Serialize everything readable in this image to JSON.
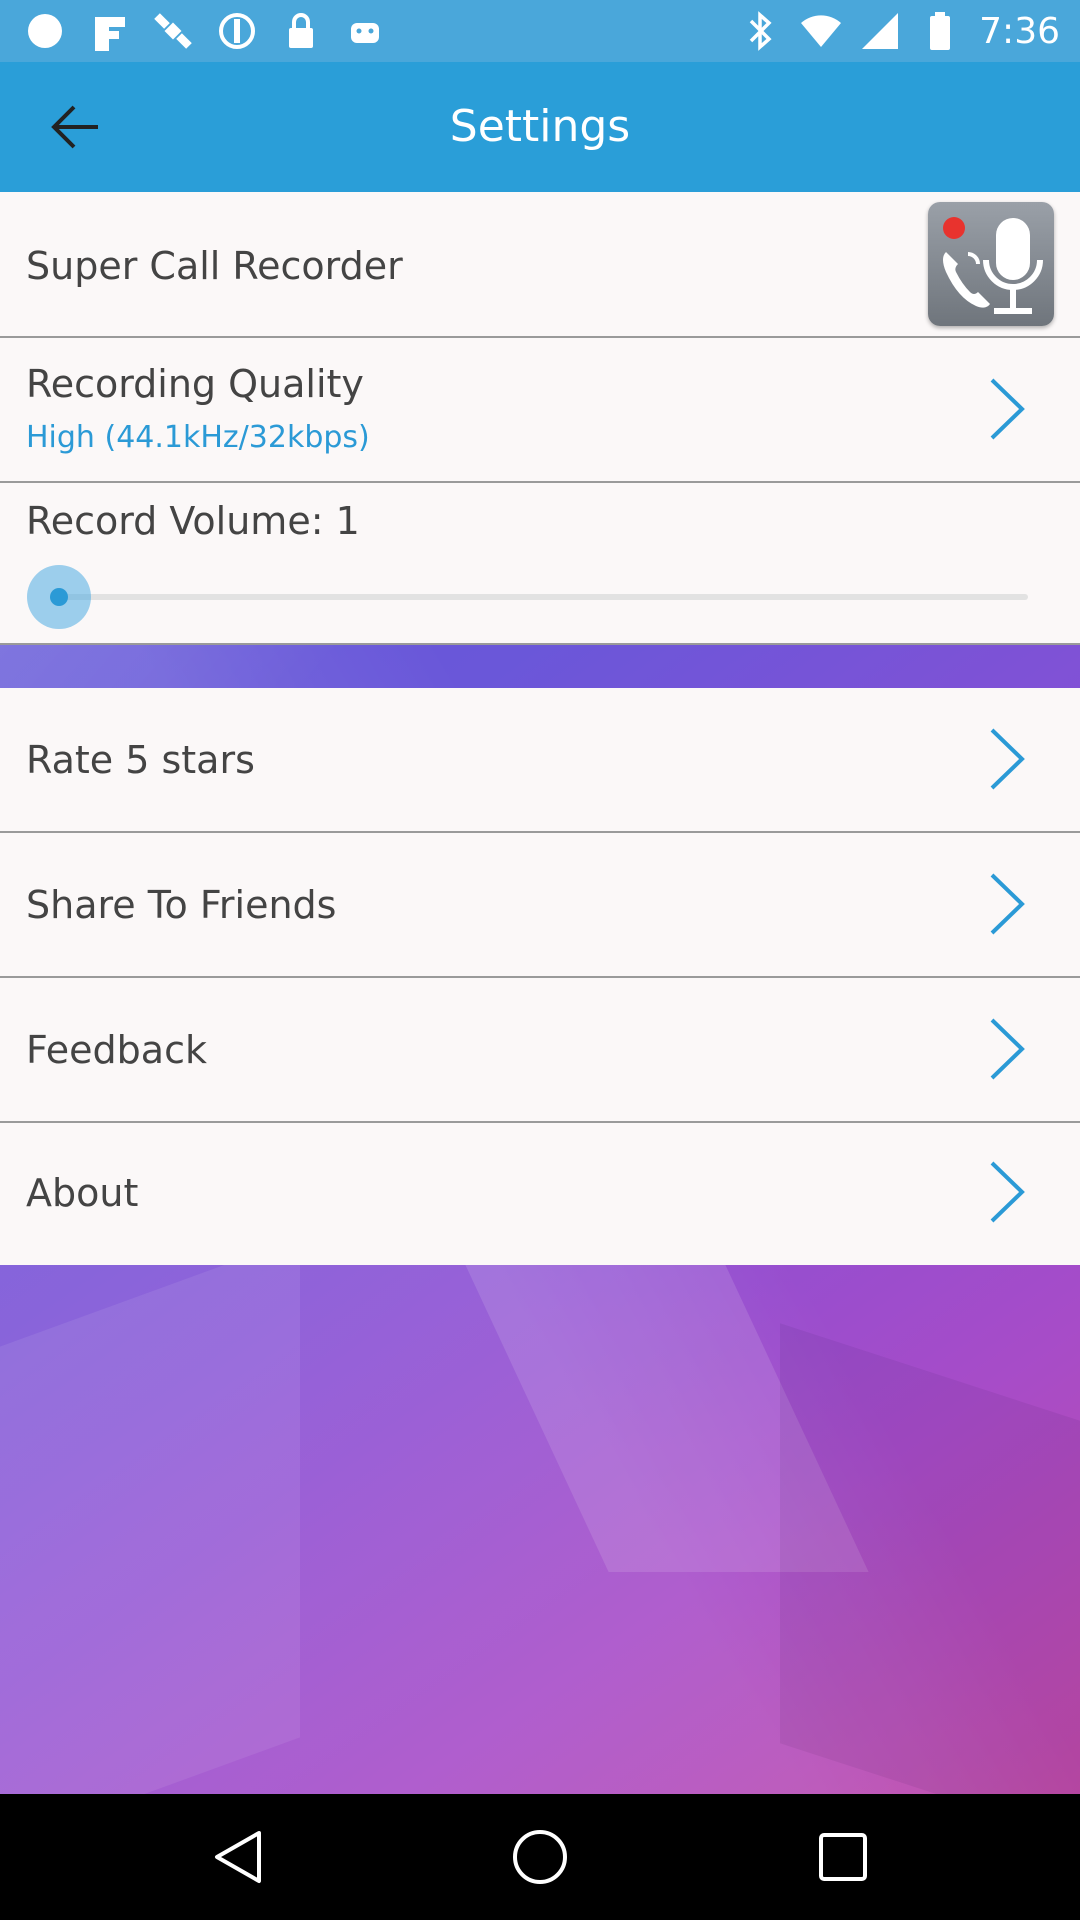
{
  "status_bar": {
    "time": "7:36",
    "left_icons": [
      "circle-notification-icon",
      "fake-gps-icon",
      "satellite-icon",
      "sync-icon",
      "lock-icon",
      "android-icon"
    ],
    "right_icons": [
      "bluetooth-icon",
      "wifi-icon",
      "signal-icon",
      "battery-icon"
    ],
    "background_color": "#4aa7da"
  },
  "app_bar": {
    "title": "Settings",
    "back_icon": "arrow-back-icon",
    "background_color": "#2a9ed8"
  },
  "settings": {
    "app_name": "Super Call Recorder",
    "recording_quality": {
      "label": "Recording Quality",
      "value": "High (44.1kHz/32kbps)"
    },
    "record_volume": {
      "label": "Record Volume: 1",
      "slider_fraction": 0.0
    },
    "menu_items": [
      {
        "label": "Rate 5 stars"
      },
      {
        "label": "Share To Friends"
      },
      {
        "label": "Feedback"
      },
      {
        "label": "About"
      }
    ]
  },
  "accent_color": "#2b9ad6",
  "nav_bar": {
    "buttons": [
      "back-triangle-icon",
      "home-circle-icon",
      "recents-square-icon"
    ]
  }
}
